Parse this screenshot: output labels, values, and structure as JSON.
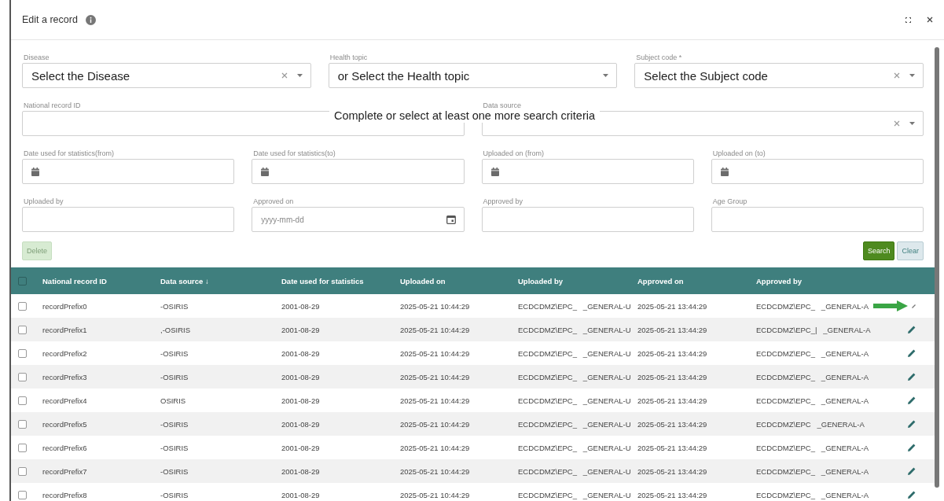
{
  "dialog": {
    "title": "Edit a record"
  },
  "filter_rows": [
    [
      {
        "label": "Disease",
        "kind": "select",
        "value": "Select the Disease",
        "clearable": true
      },
      {
        "label": "Health topic",
        "kind": "select",
        "value": "or Select the Health topic",
        "clearable": false
      },
      {
        "label": "Subject code *",
        "kind": "select",
        "value": "Select the Subject code",
        "clearable": true
      }
    ],
    [
      {
        "label": "National record ID",
        "kind": "text"
      },
      {
        "label": "Data source",
        "kind": "select",
        "clearable": true
      }
    ],
    [
      {
        "label": "Date used for statistics(from)",
        "kind": "date"
      },
      {
        "label": "Date used for statistics(to)",
        "kind": "date"
      },
      {
        "label": "Uploaded on (from)",
        "kind": "date"
      },
      {
        "label": "Uploaded on (to)",
        "kind": "date"
      }
    ],
    [
      {
        "label": "Uploaded by",
        "kind": "text"
      },
      {
        "label": "Approved on",
        "kind": "datepicker",
        "placeholder": "yyyy-mm-dd"
      },
      {
        "label": "Approved by",
        "kind": "text"
      },
      {
        "label": "Age Group",
        "kind": "text"
      }
    ]
  ],
  "validation_message": "Complete or select at least one more search criteria",
  "delete_button": {
    "label": "Delete",
    "disabled": true
  },
  "search_button": {
    "label": "Search"
  },
  "clear_button": {
    "label": "Clear"
  },
  "table": {
    "header_checked": false,
    "columns": [
      "National record ID",
      "Data source ↓",
      "Date used for statistics",
      "Uploaded on",
      "Uploaded by",
      "Approved on",
      "Approved by"
    ],
    "rows": [
      {
        "checked": false,
        "highlighted": true,
        "cells": [
          "recordPrefix0",
          "-OSIRIS",
          "2001-08-29",
          "2025-05-21 10:44:29",
          "ECDCDMZ\\EPC_   _GENERAL-U",
          "2025-05-21 13:44:29",
          "ECDCDMZ\\EPC_   _GENERAL-A"
        ]
      },
      {
        "checked": false,
        "highlighted": false,
        "cells": [
          "recordPrefix1",
          ",-OSIRIS",
          "2001-08-29",
          "2025-05-21 10:44:29",
          "ECDCDMZ\\EPC_   _GENERAL-U",
          "2025-05-21 13:44:29",
          "ECDCDMZ\\EPC_|   _GENERAL-A"
        ]
      },
      {
        "checked": false,
        "highlighted": false,
        "cells": [
          "recordPrefix2",
          "-OSIRIS",
          "2001-08-29",
          "2025-05-21 10:44:29",
          "ECDCDMZ\\EPC_   _GENERAL-U",
          "2025-05-21 13:44:29",
          "ECDCDMZ\\EPC_   _GENERAL-A"
        ]
      },
      {
        "checked": false,
        "highlighted": false,
        "cells": [
          "recordPrefix3",
          "-OSIRIS",
          "2001-08-29",
          "2025-05-21 10:44:29",
          "ECDCDMZ\\EPC_   _GENERAL-U",
          "2025-05-21 13:44:29",
          "ECDCDMZ\\EPC_   _GENERAL-A"
        ]
      },
      {
        "checked": false,
        "highlighted": false,
        "cells": [
          "recordPrefix4",
          "OSIRIS",
          "2001-08-29",
          "2025-05-21 10:44:29",
          "ECDCDMZ\\EPC_   _GENERAL-U",
          "2025-05-21 13:44:29",
          "ECDCDMZ\\EPC_   _GENERAL-A"
        ]
      },
      {
        "checked": false,
        "highlighted": false,
        "cells": [
          "recordPrefix5",
          "-OSIRIS",
          "2001-08-29",
          "2025-05-21 10:44:29",
          "ECDCDMZ\\EPC_   _GENERAL-U",
          "2025-05-21 13:44:29",
          "ECDCDMZ\\EPC   _GENERAL-A"
        ]
      },
      {
        "checked": false,
        "highlighted": false,
        "cells": [
          "recordPrefix6",
          "-OSIRIS",
          "2001-08-29",
          "2025-05-21 10:44:29",
          "ECDCDMZ\\EPC_   _GENERAL-U",
          "2025-05-21 13:44:29",
          "ECDCDMZ\\EPC_   _GENERAL-A"
        ]
      },
      {
        "checked": false,
        "highlighted": false,
        "cells": [
          "recordPrefix7",
          "-OSIRIS",
          "2001-08-29",
          "2025-05-21 10:44:29",
          "ECDCDMZ\\EPC_   _GENERAL-U",
          "2025-05-21 13:44:29",
          "ECDCDMZ\\EPC_   _GENERAL-A"
        ]
      },
      {
        "checked": false,
        "highlighted": false,
        "cells": [
          "recordPrefix8",
          "-OSIRIS",
          "2001-08-29",
          "2025-05-21 10:44:29",
          "ECDCDMZ\\EPC_   _GENERAL-U",
          "2025-05-21 13:44:29",
          "ECDCDMZ\\EPC_   _GENERAL-A"
        ]
      }
    ]
  }
}
